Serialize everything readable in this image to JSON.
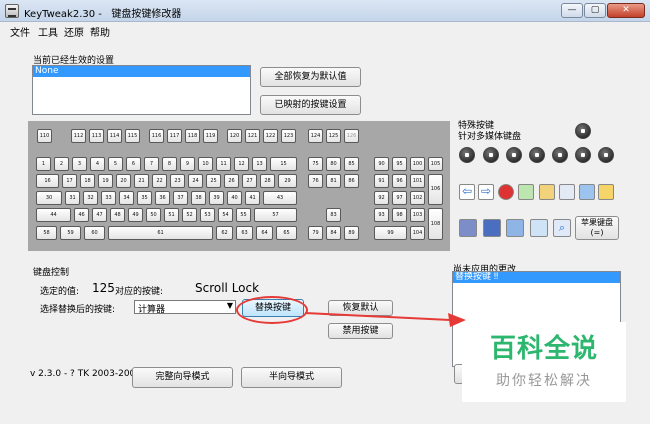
{
  "window": {
    "title": "KeyTweak2.30 -   键盘按键修改器"
  },
  "menu": [
    "文件",
    "工具",
    "还原",
    "帮助"
  ],
  "current_settings": {
    "label": "当前已经生效的设置",
    "items": [
      "None"
    ]
  },
  "buttons": {
    "restore_all": "全部恢复为默认值",
    "show_remapped": "已映射的按键设置",
    "replace_key": "替换按键",
    "restore_default": "恢复默认",
    "disable_key": "禁用按键",
    "full_teach_mode": "完整向导模式",
    "half_teach_mode": "半向导模式",
    "apple_keyboard": "苹果键盘\n(=)"
  },
  "special_keys": {
    "title": "特殊按键",
    "subtitle": "针对多媒体键盘"
  },
  "keyboard_control": {
    "label": "键盘控制",
    "selected_value_label": "选定的值:",
    "selected_value": "125",
    "mapped_key_label": "对应的按键:",
    "mapped_key": "Scroll Lock",
    "replace_label": "选择替换后的按键:",
    "replace_value": "计算器"
  },
  "pending": {
    "label": "尚未应用的更改",
    "items": [
      "替换按键 ‼"
    ]
  },
  "version": "v 2.3.0 - ? TK 2003-2009",
  "watermark": {
    "title": "百科全说",
    "subtitle": "助你轻松解决"
  },
  "keyboard": {
    "fn_row": [
      "110",
      "112",
      "113",
      "114",
      "115",
      "116",
      "117",
      "118",
      "119",
      "120",
      "121",
      "122",
      "123",
      "124",
      "125",
      "126"
    ],
    "row1": [
      "1",
      "2",
      "3",
      "4",
      "5",
      "6",
      "7",
      "8",
      "9",
      "10",
      "11",
      "12",
      "13",
      "15"
    ],
    "row2": [
      "16",
      "17",
      "18",
      "19",
      "20",
      "21",
      "22",
      "23",
      "24",
      "25",
      "26",
      "27",
      "28",
      "29"
    ],
    "row3": [
      "30",
      "31",
      "32",
      "33",
      "34",
      "35",
      "36",
      "37",
      "38",
      "39",
      "40",
      "41",
      "43"
    ],
    "row4": [
      "44",
      "46",
      "47",
      "48",
      "49",
      "50",
      "51",
      "52",
      "53",
      "54",
      "55",
      "57"
    ],
    "row5": [
      "58",
      "59",
      "60",
      "61",
      "62",
      "63",
      "64",
      "65"
    ],
    "nav_row1": [
      "75",
      "80",
      "85"
    ],
    "nav_row2": [
      "76",
      "81",
      "86"
    ],
    "nav_up": "83",
    "nav_row5": [
      "79",
      "84",
      "89"
    ],
    "num_row1": [
      "90",
      "95",
      "100",
      "105"
    ],
    "num_row2": [
      "91",
      "96",
      "101"
    ],
    "num_row3": [
      "92",
      "97",
      "102"
    ],
    "num_row4": [
      "93",
      "98",
      "103"
    ],
    "num_row5": [
      "99",
      "104"
    ],
    "num_plus": "106",
    "num_enter": "108"
  }
}
